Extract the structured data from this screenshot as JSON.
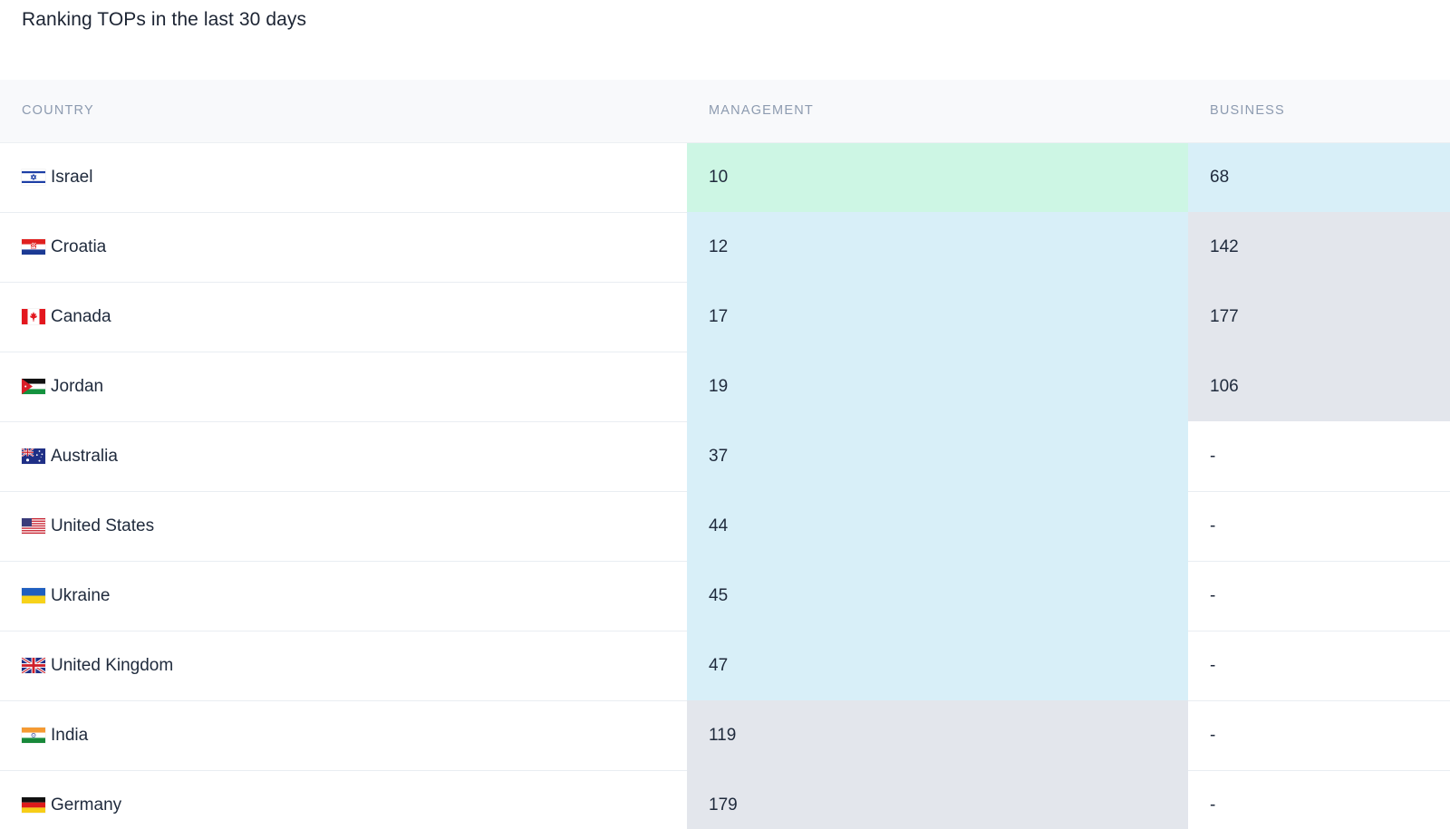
{
  "title": "Ranking TOPs in the last 30 days",
  "columns": {
    "country": "COUNTRY",
    "management": "MANAGEMENT",
    "business": "BUSINESS"
  },
  "colors": {
    "top": "#cdf6e4",
    "mid": "#d8eff8",
    "low": "#e3e6ec",
    "none": "#ffffff"
  },
  "rows": [
    {
      "country": "Israel",
      "flag": "israel-flag-icon",
      "management": "10",
      "management_tier": "top",
      "business": "68",
      "business_tier": "mid"
    },
    {
      "country": "Croatia",
      "flag": "croatia-flag-icon",
      "management": "12",
      "management_tier": "mid",
      "business": "142",
      "business_tier": "low"
    },
    {
      "country": "Canada",
      "flag": "canada-flag-icon",
      "management": "17",
      "management_tier": "mid",
      "business": "177",
      "business_tier": "low"
    },
    {
      "country": "Jordan",
      "flag": "jordan-flag-icon",
      "management": "19",
      "management_tier": "mid",
      "business": "106",
      "business_tier": "low"
    },
    {
      "country": "Australia",
      "flag": "australia-flag-icon",
      "management": "37",
      "management_tier": "mid",
      "business": "-",
      "business_tier": "none"
    },
    {
      "country": "United States",
      "flag": "united-states-flag-icon",
      "management": "44",
      "management_tier": "mid",
      "business": "-",
      "business_tier": "none"
    },
    {
      "country": "Ukraine",
      "flag": "ukraine-flag-icon",
      "management": "45",
      "management_tier": "mid",
      "business": "-",
      "business_tier": "none"
    },
    {
      "country": "United Kingdom",
      "flag": "united-kingdom-flag-icon",
      "management": "47",
      "management_tier": "mid",
      "business": "-",
      "business_tier": "none"
    },
    {
      "country": "India",
      "flag": "india-flag-icon",
      "management": "119",
      "management_tier": "low",
      "business": "-",
      "business_tier": "none"
    },
    {
      "country": "Germany",
      "flag": "germany-flag-icon",
      "management": "179",
      "management_tier": "low",
      "business": "-",
      "business_tier": "none"
    }
  ]
}
